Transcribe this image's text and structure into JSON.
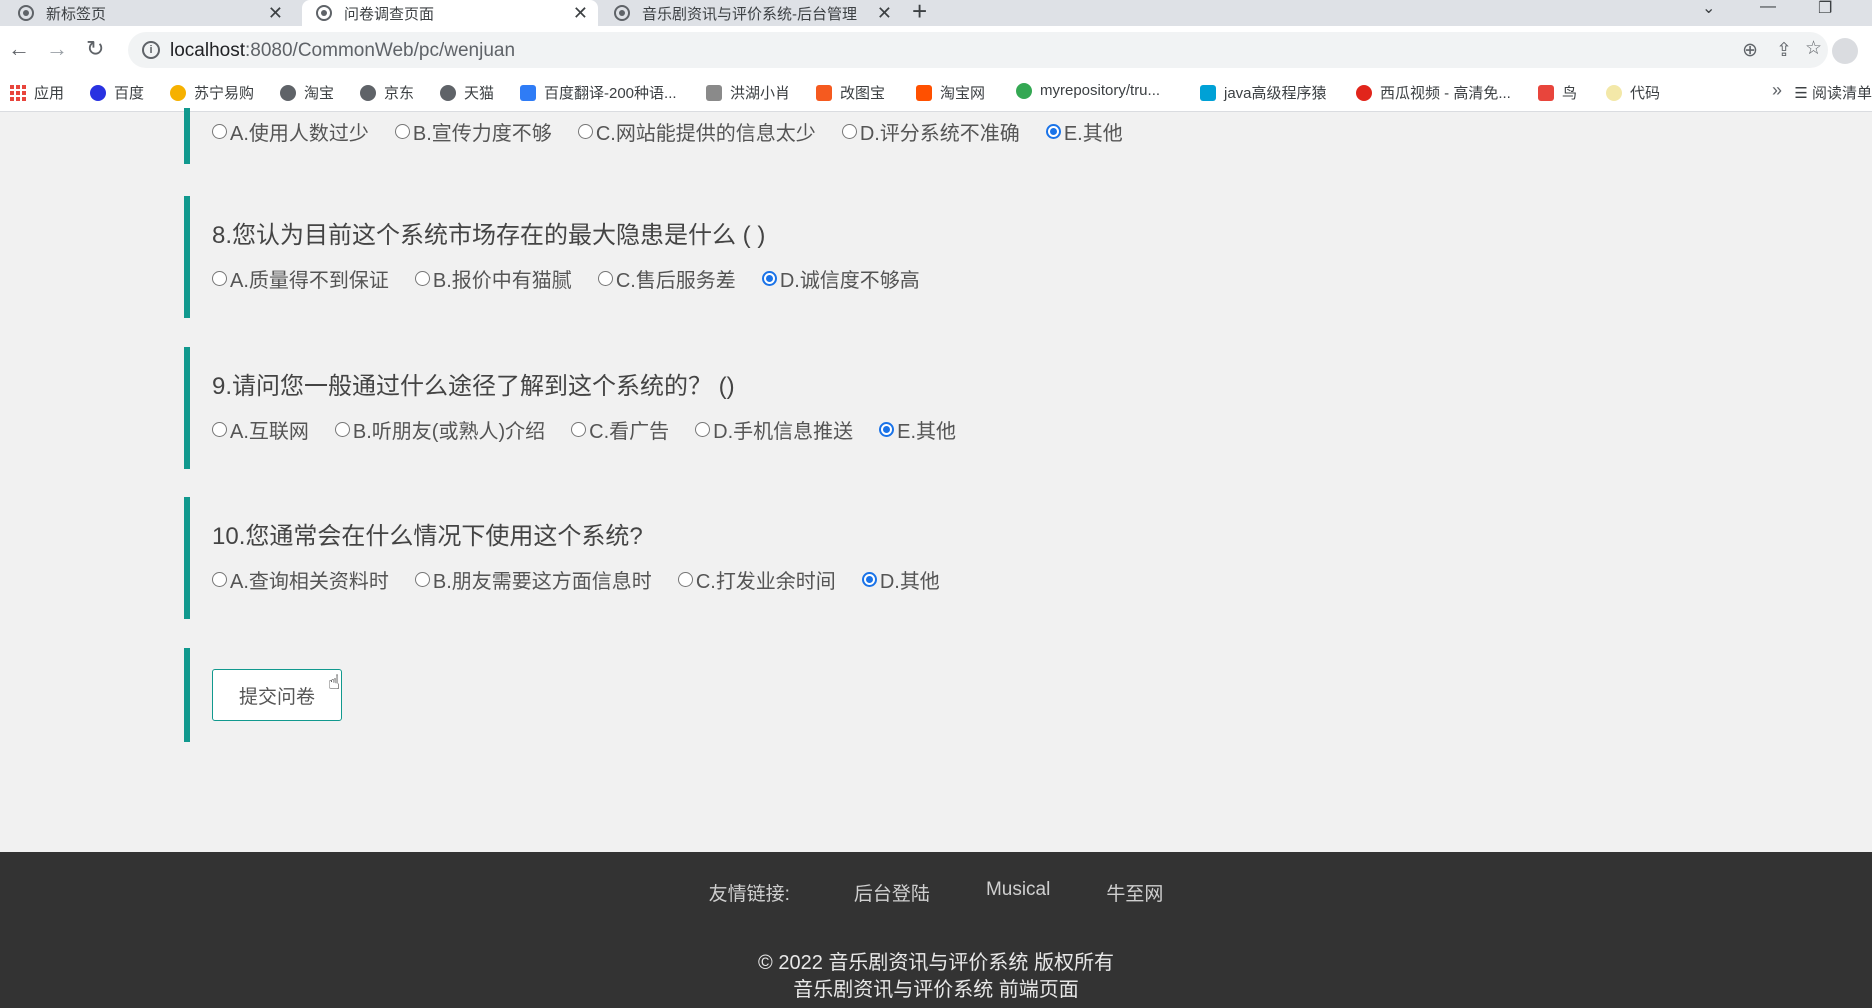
{
  "browser": {
    "tabs": [
      {
        "title": "新标签页",
        "active": false
      },
      {
        "title": "问卷调查页面",
        "active": true
      },
      {
        "title": "音乐剧资讯与评价系统-后台管理",
        "active": false
      }
    ],
    "new_tab": "+",
    "close_glyph": "✕",
    "url_host": "localhost",
    "url_rest": ":8080/CommonWeb/pc/wenjuan",
    "bookmarks": [
      "应用",
      "百度",
      "苏宁易购",
      "淘宝",
      "京东",
      "天猫",
      "百度翻译-200种语...",
      "洪湖小肖",
      "改图宝",
      "淘宝网",
      "myrepository/tru...",
      "java高级程序猿",
      "西瓜视频 - 高清免...",
      "鸟",
      "代码"
    ],
    "bookmark_more": "»",
    "reading_list": "阅读清单"
  },
  "questions": [
    {
      "title": "",
      "options": [
        {
          "label": "A.使用人数过少",
          "checked": false
        },
        {
          "label": "B.宣传力度不够",
          "checked": false
        },
        {
          "label": "C.网站能提供的信息太少",
          "checked": false
        },
        {
          "label": "D.评分系统不准确",
          "checked": false
        },
        {
          "label": "E.其他",
          "checked": true
        }
      ]
    },
    {
      "title": "8.您认为目前这个系统市场存在的最大隐患是什么 ( )",
      "options": [
        {
          "label": "A.质量得不到保证",
          "checked": false
        },
        {
          "label": "B.报价中有猫腻",
          "checked": false
        },
        {
          "label": "C.售后服务差",
          "checked": false
        },
        {
          "label": "D.诚信度不够高",
          "checked": true
        }
      ]
    },
    {
      "title": "9.请问您一般通过什么途径了解到这个系统的？ ()",
      "options": [
        {
          "label": "A.互联网",
          "checked": false
        },
        {
          "label": "B.听朋友(或熟人)介绍",
          "checked": false
        },
        {
          "label": "C.看广告",
          "checked": false
        },
        {
          "label": "D.手机信息推送",
          "checked": false
        },
        {
          "label": "E.其他",
          "checked": true
        }
      ]
    },
    {
      "title": "10.您通常会在什么情况下使用这个系统?",
      "options": [
        {
          "label": "A.查询相关资料时",
          "checked": false
        },
        {
          "label": "B.朋友需要这方面信息时",
          "checked": false
        },
        {
          "label": "C.打发业余时间",
          "checked": false
        },
        {
          "label": "D.其他",
          "checked": true
        }
      ]
    }
  ],
  "submit_label": "提交问卷",
  "footer": {
    "links_label": "友情链接:",
    "links": [
      "后台登陆",
      "Musical",
      "牛至网"
    ],
    "copyright": "© 2022 音乐剧资讯与评价系统 版权所有",
    "subtitle": "音乐剧资讯与评价系统 前端页面"
  }
}
